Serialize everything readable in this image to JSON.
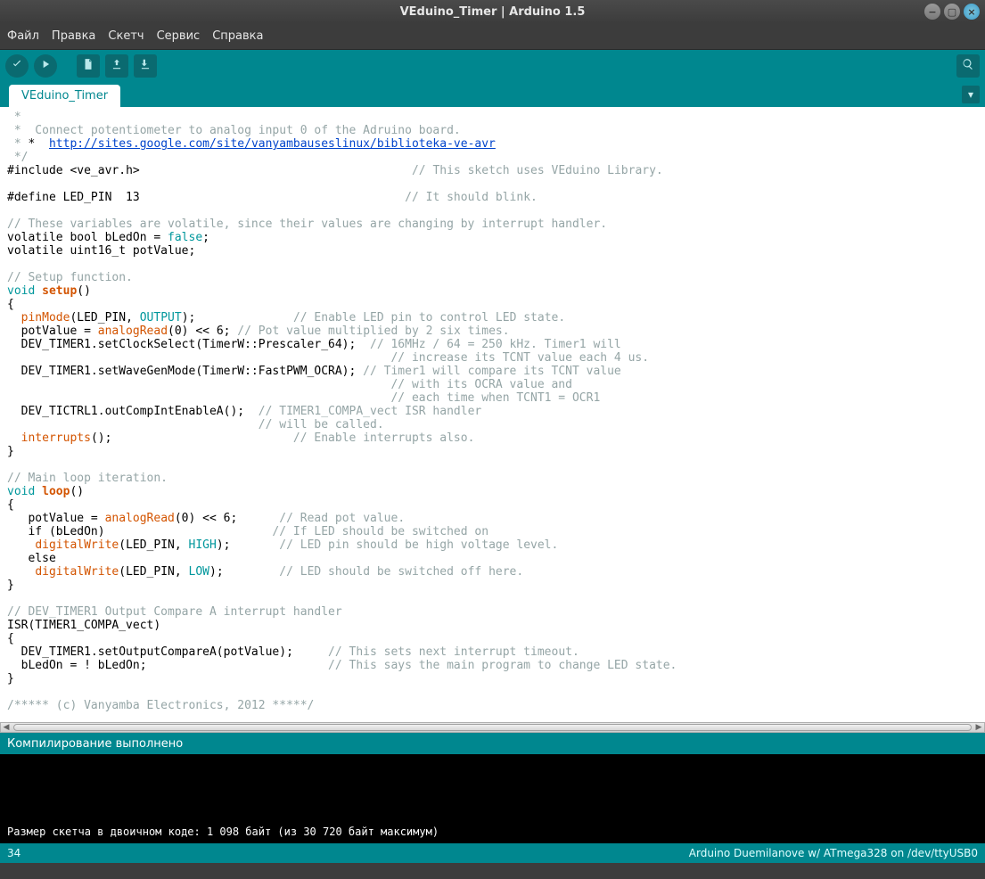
{
  "window": {
    "title": "VEduino_Timer | Arduino 1.5"
  },
  "menu": {
    "file": "Файл",
    "edit": "Правка",
    "sketch": "Скетч",
    "service": "Сервис",
    "help": "Справка"
  },
  "tabs": {
    "active": "VEduino_Timer"
  },
  "code": {
    "comment_top1": " *",
    "comment_top2": " *  Connect potentiometer to analog input 0 of the Adruino board.",
    "comment_top3": " *",
    "link": "http://sites.google.com/site/vanyambauseslinux/biblioteka-ve-avr",
    "comment_end": " */",
    "include_pre": "#include ",
    "include_file": "<ve_avr.h>",
    "include_cmt": "// This sketch uses VEduino Library.",
    "define_pre": "#define LED_PIN  13",
    "define_cmt": "// It should blink.",
    "vola_cmt": "// These variables are volatile, since their values are changing by interrupt handler.",
    "vola1_pre": "volatile bool bLedOn = ",
    "vola1_val": "false",
    "vola2": "volatile uint16_t potValue;",
    "setup_cmt": "// Setup function.",
    "void": "void",
    "setup": "setup",
    "pinMode": "pinMode",
    "ledpin": "LED_PIN",
    "output": "OUTPUT",
    "pinmode_cmt": "// Enable LED pin to control LED state.",
    "ar_line": "  potValue = ",
    "analogRead": "analogRead",
    "ar_suffix": "(0) << 6;",
    "ar_cmt": " // Pot value multiplied by 2 six times.",
    "cs_line": "  DEV_TIMER1.setClockSelect(TimerW::Prescaler_64);",
    "cs_cmt1": "  // 16MHz / 64 = 250 kHz. Timer1 will",
    "cs_cmt2": "                                                       // increase its TCNT value each 4 us.",
    "wg_line": "  DEV_TIMER1.setWaveGenMode(TimerW::FastPWM_OCRA);",
    "wg_cmt1": " // Timer1 will compare its TCNT value",
    "wg_cmt2": "                                                       // with its OCRA value and",
    "wg_cmt3": "                                                       // each time when TCNT1 = OCR1",
    "tc_line": "  DEV_TICTRL1.outCompIntEnableA();",
    "tc_cmt1": "  // TIMER1_COMPA_vect ISR handler",
    "tc_cmt2": "                                    // will be called.",
    "intr_func": "interrupts",
    "intr_cmt": "// Enable interrupts also.",
    "loop_cmt": "// Main loop iteration.",
    "loop": "loop",
    "lp_pot_pre": "   potValue = ",
    "lp_pot_suf": "(0) << 6;",
    "lp_pot_cmt": "      // Read pot value.",
    "lp_if": "   if (bLedOn)",
    "lp_if_cmt": "                        // If LED should be switched on",
    "digitalWrite": "digitalWrite",
    "high": "HIGH",
    "low": "LOW",
    "dw_hi_cmt": "       // LED pin should be high voltage level.",
    "else": "   else",
    "dw_lo_cmt": "        // LED should be switched off here.",
    "isr_cmt": "// DEV_TIMER1 Output Compare A interrupt handler",
    "isr_line": "ISR(TIMER1_COMPA_vect)",
    "isr_body1": "  DEV_TIMER1.setOutputCompareA(potValue);",
    "isr_body1_cmt": "     // This sets next interrupt timeout.",
    "isr_body2": "  bLedOn = ! bLedOn;",
    "isr_body2_cmt": "                          // This says the main program to change LED state.",
    "copyright": "/***** (c) Vanyamba Electronics, 2012 *****/"
  },
  "status": {
    "msg": "Компилирование выполнено"
  },
  "console": {
    "line": "Размер скетча в двоичном коде: 1 098 байт (из 30 720 байт максимум)"
  },
  "footer": {
    "line": "34",
    "board": "Arduino Duemilanove w/ ATmega328 on /dev/ttyUSB0"
  }
}
